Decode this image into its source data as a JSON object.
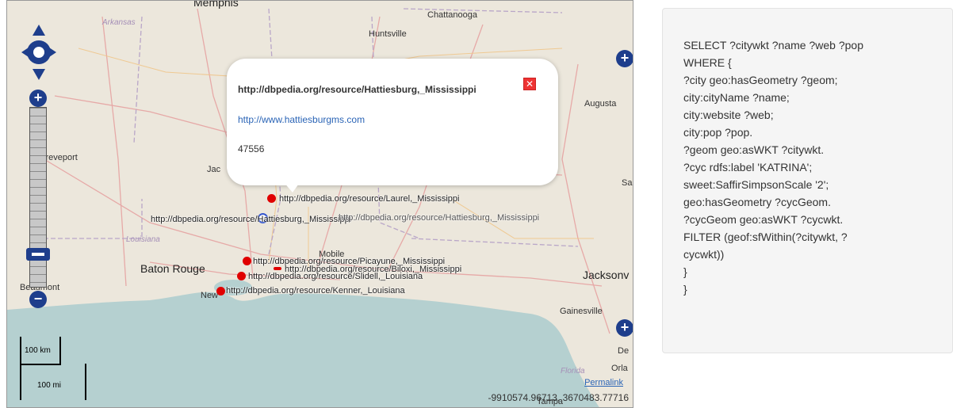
{
  "map": {
    "city_labels": [
      {
        "text": "Memphis"
      },
      {
        "text": "Chattanooga"
      },
      {
        "text": "Huntsville"
      },
      {
        "text": "Arkansas"
      },
      {
        "text": "Shreveport"
      },
      {
        "text": "Augusta"
      },
      {
        "text": "Jac"
      },
      {
        "text": "Sa"
      },
      {
        "text": "Louisiana"
      },
      {
        "text": "Baton Rouge"
      },
      {
        "text": "Mobile"
      },
      {
        "text": "Jacksonv"
      },
      {
        "text": "Beaumont"
      },
      {
        "text": "New"
      },
      {
        "text": "Gainesville"
      },
      {
        "text": "De"
      },
      {
        "text": "Florida"
      },
      {
        "text": "Orla"
      },
      {
        "text": "Tampa"
      }
    ],
    "markers": [
      {
        "label": "http://dbpedia.org/resource/Laurel,_Mississippi"
      },
      {
        "label": "http://dbpedia.org/resource/Hattiesburg,_Mississippi"
      },
      {
        "label": "http://dbpedia.org/resource/Picayune,_Mississippi"
      },
      {
        "label": "http://dbpedia.org/resource/Biloxi,_Mississippi"
      },
      {
        "label": "http://dbpedia.org/resource/Slidell,_Louisiana"
      },
      {
        "label": "http://dbpedia.org/resource/Kenner,_Louisiana"
      }
    ],
    "popup": {
      "title": "http://dbpedia.org/resource/Hattiesburg,_Mississippi",
      "website": "http://www.hattiesburgms.com",
      "population": "47556",
      "close_icon": "close-icon"
    },
    "scale": {
      "km": "100 km",
      "mi": "100 mi"
    },
    "permalink": "Permalink",
    "coordinates": "-9910574.96713, 3670483.77716"
  },
  "query": {
    "lines": [
      "SELECT ?citywkt ?name ?web ?pop",
      "WHERE {",
      "?city geo:hasGeometry ?geom;",
      "city:cityName ?name;",
      "city:website ?web;",
      "city:pop ?pop.",
      "?geom geo:asWKT ?citywkt.",
      "?cyc rdfs:label 'KATRINA';",
      "sweet:SaffirSimpsonScale '2';",
      "geo:hasGeometry ?cycGeom.",
      "?cycGeom geo:asWKT ?cycwkt.",
      "FILTER (geof:sfWithin(?citywkt, ?",
      "cycwkt))",
      "}",
      "}"
    ]
  },
  "colors": {
    "marker": "#e00000",
    "control": "#1e3e8c",
    "link": "#2a64b6"
  }
}
